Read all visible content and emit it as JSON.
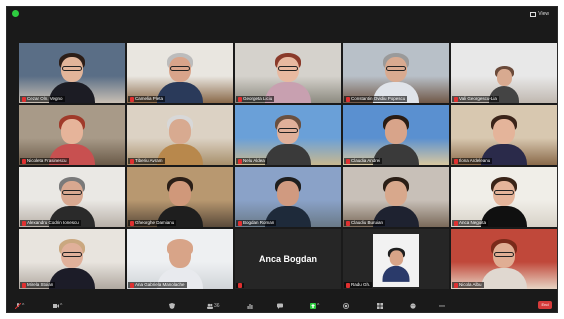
{
  "window": {
    "view_label": "View"
  },
  "participants": [
    {
      "name": "Cezar Oln. Vegno",
      "active": false,
      "scene": [
        "#5a6e86",
        "#c9c0b4"
      ],
      "skin": "#e2b59a",
      "hair": "#2c1e18",
      "shirt": "#1c1c24",
      "glasses": true
    },
    {
      "name": "Camelia Pleta",
      "active": false,
      "scene": [
        "#e9e6e0",
        "#8a6a4a"
      ],
      "skin": "#d9a48a",
      "hair": "#bcbcbc",
      "shirt": "#2a3a5a",
      "glasses": true
    },
    {
      "name": "Georgeta Liciu",
      "active": false,
      "scene": [
        "#d5d2cc",
        "#8c8a80"
      ],
      "skin": "#e8b9a0",
      "hair": "#8a3a2a",
      "shirt": "#c8a0b0",
      "glasses": true
    },
    {
      "name": "Constantin Ovidiu Popescu",
      "active": false,
      "scene": [
        "#b8c0c8",
        "#705848"
      ],
      "skin": "#d8aa90",
      "hair": "#9a9a9a",
      "shirt": "#e0e4ea",
      "glasses": true
    },
    {
      "name": "Vali Georgescu-Lia",
      "active": false,
      "scene": [
        "#e8e8e8",
        "#c0b8b0"
      ],
      "skin": "#d8aa90",
      "hair": "#6a4a3a",
      "shirt": "#444444",
      "glasses": false,
      "small": true
    },
    {
      "name": "Nicoleta Frasinescu",
      "active": false,
      "scene": [
        "#a89a88",
        "#6a5a48"
      ],
      "skin": "#e6b49a",
      "hair": "#a03a2a",
      "shirt": "#c85050",
      "glasses": false
    },
    {
      "name": "Tiberiu Avram",
      "active": false,
      "scene": [
        "#dcd2c4",
        "#a8906c"
      ],
      "skin": "#d8aa90",
      "hair": "#d8d8d8",
      "shirt": "#b8884c",
      "glasses": false
    },
    {
      "name": "Nelu Aldea",
      "active": false,
      "scene": [
        "#6aa0d8",
        "#c8b890"
      ],
      "skin": "#e0b09a",
      "hair": "#6a5040",
      "shirt": "#3a3a3a",
      "glasses": true
    },
    {
      "name": "Claudia Andrei",
      "active": false,
      "scene": [
        "#5a90d0",
        "#d8c8a0"
      ],
      "skin": "#d8a48a",
      "hair": "#2a1c14",
      "shirt": "#3a3a3a",
      "glasses": false
    },
    {
      "name": "Ilona Ardeleanu",
      "active": false,
      "scene": [
        "#d8c8b0",
        "#8a6a4a"
      ],
      "skin": "#e4b49a",
      "hair": "#3a241a",
      "shirt": "#2a2a4a",
      "glasses": false
    },
    {
      "name": "Alexandru Codrin Ionescu",
      "active": false,
      "scene": [
        "#eae8e4",
        "#b8b0a8"
      ],
      "skin": "#d8a890",
      "hair": "#7a7a7a",
      "shirt": "#2a2a2a",
      "glasses": true
    },
    {
      "name": "Gheorghe Damianu",
      "active": false,
      "scene": [
        "#b89870",
        "#5a4a3a"
      ],
      "skin": "#d0987a",
      "hair": "#2a1e16",
      "shirt": "#1e1e1e",
      "glasses": false
    },
    {
      "name": "Bogdan Roman",
      "active": true,
      "scene": [
        "#8aa2c8",
        "#6a7a88"
      ],
      "skin": "#d09a80",
      "hair": "#1e1e1e",
      "shirt": "#1e2a3a",
      "glasses": false
    },
    {
      "name": "Claudiu Buruian",
      "active": false,
      "scene": [
        "#c8c0b8",
        "#7a6a5a"
      ],
      "skin": "#d8a88c",
      "hair": "#2a1e16",
      "shirt": "#1e2230",
      "glasses": false
    },
    {
      "name": "Anca Negoita",
      "active": false,
      "scene": [
        "#f0eee8",
        "#d8d2c8"
      ],
      "skin": "#e4b49a",
      "hair": "#3a2418",
      "shirt": "#101010",
      "glasses": true
    },
    {
      "name": "Mirela Stoian",
      "active": false,
      "scene": [
        "#e8e4de",
        "#b0a8a0"
      ],
      "skin": "#e0b09a",
      "hair": "#caa880",
      "shirt": "#1c1c28",
      "glasses": true
    },
    {
      "name": "Ana Gabriela Manolache",
      "active": false,
      "scene": [
        "#eef0f2",
        "#d0d4d8"
      ],
      "skin": "#d8a488",
      "hair": "#d8a488",
      "shirt": "#e8eaee",
      "glasses": false
    },
    {
      "name": "Anca Bogdan",
      "active": false,
      "scene": [
        "#262626",
        "#262626"
      ],
      "no_video": true
    },
    {
      "name": "Radu Gh.",
      "active": false,
      "scene": [
        "#262626",
        "#f2f2f2"
      ],
      "skin": "#d8a488",
      "hair": "#1e1e1e",
      "shirt": "#2a3a6a",
      "glasses": false,
      "small": true,
      "card": true
    },
    {
      "name": "Nicola Albu",
      "active": false,
      "scene": [
        "#c0483a",
        "#e8d4c4"
      ],
      "skin": "#e0ae94",
      "hair": "#7a2a1a",
      "shirt": "#e0d8d0",
      "glasses": true
    }
  ],
  "toolbar": {
    "mute_label": "^",
    "video_label": "^",
    "participants_count": "36",
    "end_label": "End"
  },
  "colors": {
    "active_speaker": "#c8e06a",
    "end": "#d63b3b",
    "window_bg": "#1a1a1a"
  }
}
